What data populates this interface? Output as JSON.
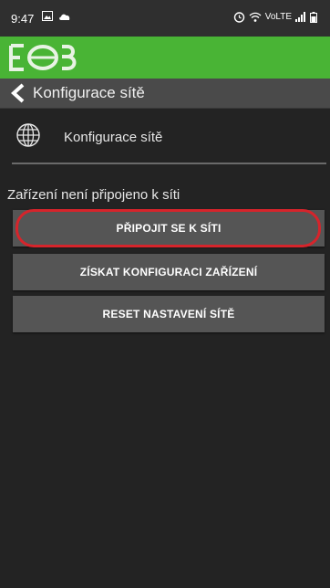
{
  "status_bar": {
    "time": "9:47",
    "network_label": "VoLTE"
  },
  "brand": {
    "accent_color": "#49b435",
    "logo_icon": "eob-logo"
  },
  "title_bar": {
    "title": "Konfigurace sítě"
  },
  "section": {
    "label": "Konfigurace sítě",
    "icon": "globe-icon"
  },
  "status_message": "Zařízení není připojeno k síti",
  "buttons": {
    "connect": "PŘIPOJIT SE K SÍTI",
    "get_config": "ZÍSKAT KONFIGURACI ZAŘÍZENÍ",
    "reset": "RESET NASTAVENÍ SÍTĚ"
  },
  "highlight_color": "#d6242b"
}
